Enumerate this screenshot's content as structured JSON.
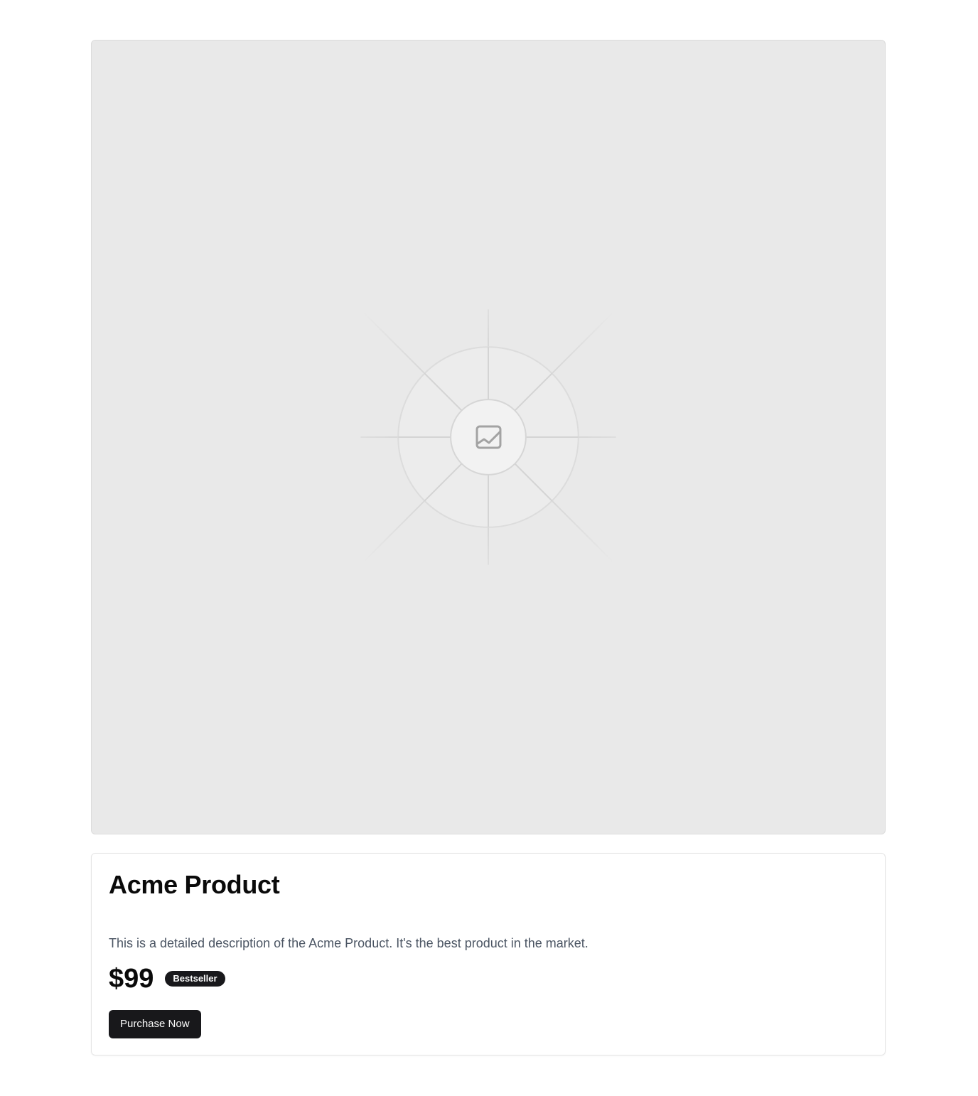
{
  "product": {
    "image_icon": "image-icon",
    "title": "Acme Product",
    "description": "This is a detailed description of the Acme Product. It's the best product in the market.",
    "price": "$99",
    "badge": "Bestseller",
    "purchase_label": "Purchase Now"
  },
  "colors": {
    "placeholder_bg": "#e9e9e9",
    "primary": "#18181b",
    "text": "#0a0a0a",
    "muted_text": "#4b5563"
  }
}
